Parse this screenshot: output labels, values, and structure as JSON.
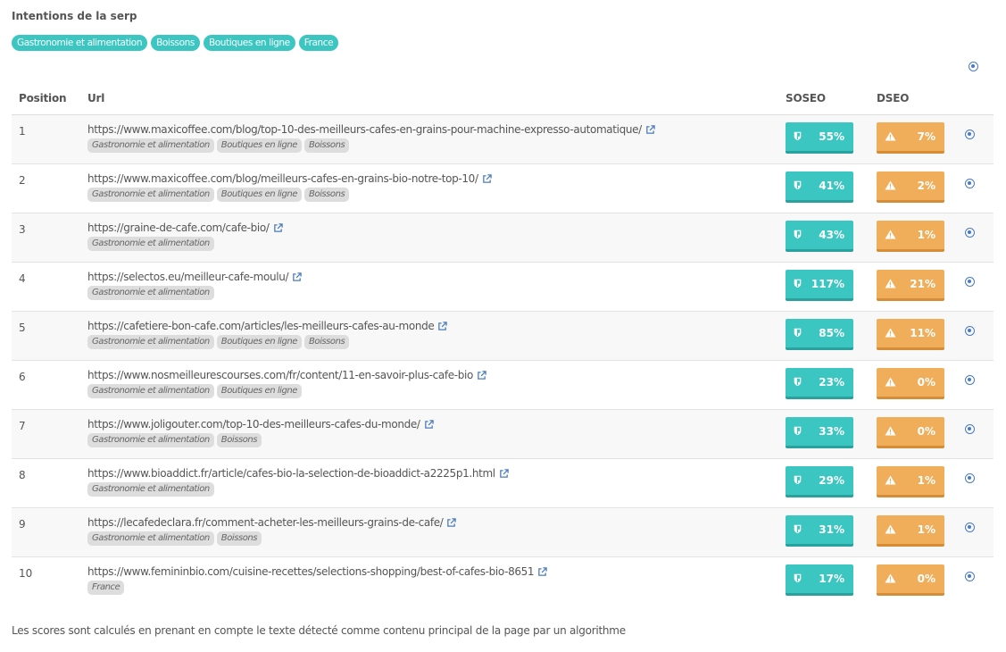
{
  "title": "Intentions de la serp",
  "intent_tags": [
    "Gastronomie et alimentation",
    "Boissons",
    "Boutiques en ligne",
    "France"
  ],
  "headers": {
    "position": "Position",
    "url": "Url",
    "soseo": "SOSEO",
    "dseo": "DSEO"
  },
  "rows": [
    {
      "position": "1",
      "url": "https://www.maxicoffee.com/blog/top-10-des-meilleurs-cafes-en-grains-pour-machine-expresso-automatique/",
      "tags": [
        "Gastronomie et alimentation",
        "Boutiques en ligne",
        "Boissons"
      ],
      "soseo": "55%",
      "dseo": "7%"
    },
    {
      "position": "2",
      "url": "https://www.maxicoffee.com/blog/meilleurs-cafes-en-grains-bio-notre-top-10/",
      "tags": [
        "Gastronomie et alimentation",
        "Boutiques en ligne",
        "Boissons"
      ],
      "soseo": "41%",
      "dseo": "2%"
    },
    {
      "position": "3",
      "url": "https://graine-de-cafe.com/cafe-bio/",
      "tags": [
        "Gastronomie et alimentation"
      ],
      "soseo": "43%",
      "dseo": "1%"
    },
    {
      "position": "4",
      "url": "https://selectos.eu/meilleur-cafe-moulu/",
      "tags": [
        "Gastronomie et alimentation"
      ],
      "soseo": "117%",
      "dseo": "21%"
    },
    {
      "position": "5",
      "url": "https://cafetiere-bon-cafe.com/articles/les-meilleurs-cafes-au-monde",
      "tags": [
        "Gastronomie et alimentation",
        "Boutiques en ligne",
        "Boissons"
      ],
      "soseo": "85%",
      "dseo": "11%"
    },
    {
      "position": "6",
      "url": "https://www.nosmeilleurescourses.com/fr/content/11-en-savoir-plus-cafe-bio",
      "tags": [
        "Gastronomie et alimentation",
        "Boutiques en ligne"
      ],
      "soseo": "23%",
      "dseo": "0%"
    },
    {
      "position": "7",
      "url": "https://www.joligouter.com/top-10-des-meilleurs-cafes-du-monde/",
      "tags": [
        "Gastronomie et alimentation",
        "Boissons"
      ],
      "soseo": "33%",
      "dseo": "0%"
    },
    {
      "position": "8",
      "url": "https://www.bioaddict.fr/article/cafes-bio-la-selection-de-bioaddict-a2225p1.html",
      "tags": [
        "Gastronomie et alimentation"
      ],
      "soseo": "29%",
      "dseo": "1%"
    },
    {
      "position": "9",
      "url": "https://lecafedeclara.fr/comment-acheter-les-meilleurs-grains-de-cafe/",
      "tags": [
        "Gastronomie et alimentation",
        "Boissons"
      ],
      "soseo": "31%",
      "dseo": "1%"
    },
    {
      "position": "10",
      "url": "https://www.femininbio.com/cuisine-recettes/selections-shopping/best-of-cafes-bio-8651",
      "tags": [
        "France"
      ],
      "soseo": "17%",
      "dseo": "0%"
    }
  ],
  "footer": "Les scores sont calculés en prenant en compte le texte détecté comme contenu principal de la page par un algorithme",
  "colors": {
    "soseo": "#3cc6c1",
    "dseo": "#f0ad5a",
    "tag_bg": "#dddddd",
    "link_icon": "#4a7bbd"
  },
  "icons": {
    "soseo": "shield-icon",
    "dseo": "warning-icon",
    "external": "external-link-icon",
    "view": "eye-icon"
  }
}
